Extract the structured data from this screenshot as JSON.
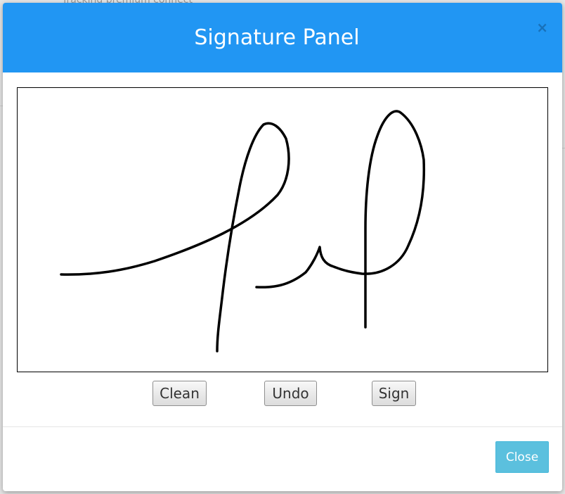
{
  "background": {
    "partial_text": "Tracking premium connect"
  },
  "modal": {
    "title": "Signature Panel",
    "close_icon_glyph": "×",
    "header_color": "#2196f3"
  },
  "pad_buttons": {
    "clean_label": "Clean",
    "undo_label": "Undo",
    "sign_label": "Sign"
  },
  "footer": {
    "close_label": "Close",
    "close_color": "#5bc0de"
  }
}
